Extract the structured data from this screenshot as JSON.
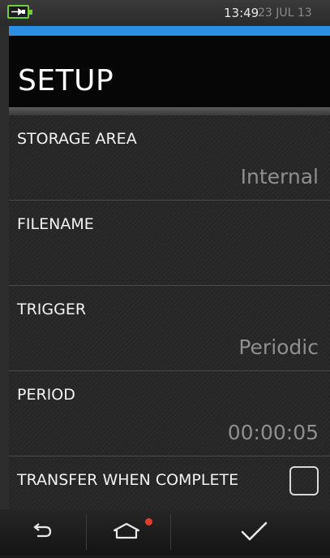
{
  "status_bar": {
    "time": "13:49",
    "date": "23 JUL 13",
    "battery_icon": "battery-charging-icon",
    "accent_color": "#2a8fe3"
  },
  "header": {
    "title": "SETUP"
  },
  "settings": [
    {
      "label": "STORAGE AREA",
      "value": "Internal"
    },
    {
      "label": "FILENAME",
      "value": ""
    },
    {
      "label": "TRIGGER",
      "value": "Periodic"
    },
    {
      "label": "PERIOD",
      "value": "00:00:05"
    }
  ],
  "transfer": {
    "label": "TRANSFER WHEN COMPLETE",
    "checked": false
  },
  "nav": {
    "back_icon": "back-arrow-icon",
    "home_icon": "home-icon",
    "confirm_icon": "checkmark-icon",
    "home_badge_color": "#e0402a"
  }
}
